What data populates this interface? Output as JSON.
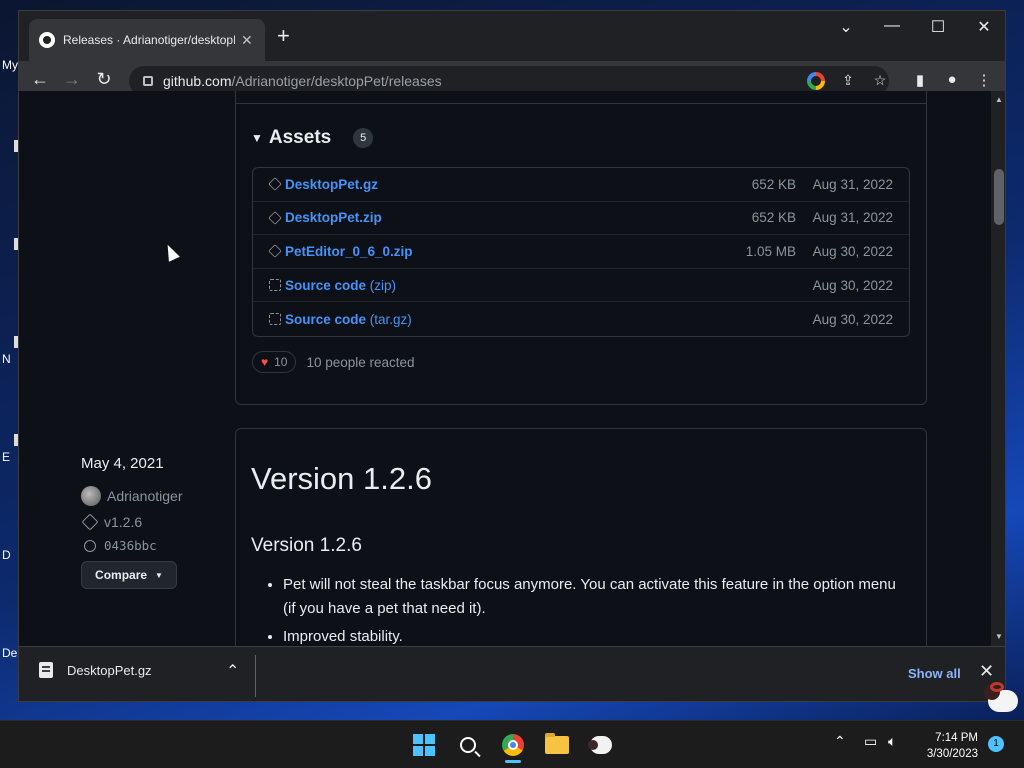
{
  "desktop": {
    "labels": [
      "My",
      "N",
      "E",
      "D",
      "De"
    ]
  },
  "browser": {
    "tab_title": "Releases · Adrianotiger/desktopPet",
    "tab_close": "✕",
    "new_tab": "+",
    "url_host": "github.com",
    "url_path": "/Adrianotiger/desktopPet/releases",
    "controls": {
      "dropdown": "⌄",
      "minimize": "—",
      "maximize": "☐",
      "close": "✕"
    }
  },
  "assets": {
    "heading": "Assets",
    "count": "5",
    "items": [
      {
        "name": "DesktopPet.gz",
        "ext": "",
        "size": "652 KB",
        "date": "Aug 31, 2022",
        "icon": "package-icon"
      },
      {
        "name": "DesktopPet.zip",
        "ext": "",
        "size": "652 KB",
        "date": "Aug 31, 2022",
        "icon": "package-icon"
      },
      {
        "name": "PetEditor_0_6_0.zip",
        "ext": "",
        "size": "1.05 MB",
        "date": "Aug 30, 2022",
        "icon": "package-icon"
      },
      {
        "name": "Source code",
        "ext": "(zip)",
        "size": "",
        "date": "Aug 30, 2022",
        "icon": "file-zip-icon"
      },
      {
        "name": "Source code",
        "ext": "(tar.gz)",
        "size": "",
        "date": "Aug 30, 2022",
        "icon": "file-zip-icon"
      }
    ]
  },
  "reactions": {
    "heart": "♥",
    "count": "10",
    "text": "10 people reacted"
  },
  "release": {
    "date": "May 4, 2021",
    "author": "Adrianotiger",
    "tag": "v1.2.6",
    "commit": "0436bbc",
    "compare_label": "Compare",
    "title": "Version 1.2.6",
    "subtitle": "Version 1.2.6",
    "notes": [
      "Pet will not steal the taskbar focus anymore. You can activate this feature in the option menu (if you have a pet that need it).",
      "Improved stability."
    ]
  },
  "downloads": {
    "file_name": "DesktopPet.gz",
    "show_all": "Show all",
    "close": "✕"
  },
  "taskbar": {
    "time": "7:14 PM",
    "date": "3/30/2023",
    "notifications": "1"
  }
}
